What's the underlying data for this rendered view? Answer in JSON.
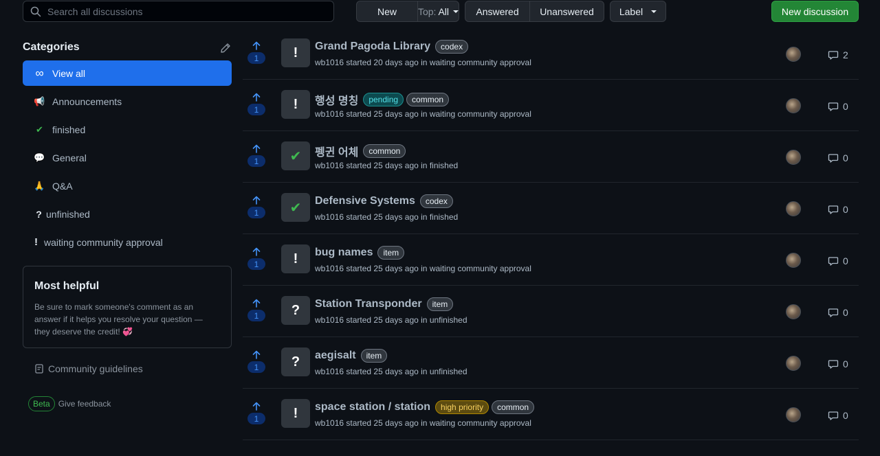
{
  "toolbar": {
    "search_placeholder": "Search all discussions",
    "new_label": "New",
    "top_prefix": "Top:",
    "top_value": "All",
    "answered_label": "Answered",
    "unanswered_label": "Unanswered",
    "label_label": "Label",
    "new_discussion_label": "New discussion"
  },
  "sidebar": {
    "title": "Categories",
    "items": [
      {
        "label": "View all",
        "icon": "infinity-icon",
        "glyph": "∞",
        "active": true
      },
      {
        "label": "Announcements",
        "icon": "megaphone-icon",
        "glyph": "📢"
      },
      {
        "label": "finished",
        "icon": "check-icon",
        "glyph": "✔"
      },
      {
        "label": "General",
        "icon": "speech-bubble-icon",
        "glyph": "💬"
      },
      {
        "label": "Q&A",
        "icon": "pray-icon",
        "glyph": "🙏"
      },
      {
        "label": "unfinished",
        "icon": "question-icon",
        "glyph": "?"
      },
      {
        "label": "waiting community approval",
        "icon": "exclamation-icon",
        "glyph": "!"
      }
    ],
    "helpful": {
      "title": "Most helpful",
      "text": "Be sure to mark someone's comment as an answer if it helps you resolve your question — they deserve the credit!",
      "emoji": "💞"
    },
    "guidelines_label": "Community guidelines",
    "beta_label": "Beta",
    "feedback_label": "Give feedback"
  },
  "discussions": [
    {
      "title": "Grand Pagoda Library",
      "labels": [
        {
          "text": "codex",
          "kind": "default"
        }
      ],
      "author": "wb1016",
      "when": "started 20 days ago in",
      "category": "waiting community approval",
      "category_glyph": "!",
      "votes": "1",
      "comments": "2"
    },
    {
      "title": "행성 명칭",
      "labels": [
        {
          "text": "pending",
          "kind": "pending"
        },
        {
          "text": "common",
          "kind": "default"
        }
      ],
      "author": "wb1016",
      "when": "started 25 days ago in",
      "category": "waiting community approval",
      "category_glyph": "!",
      "votes": "1",
      "comments": "0"
    },
    {
      "title": "펭귄 어체",
      "labels": [
        {
          "text": "common",
          "kind": "default"
        }
      ],
      "author": "wb1016",
      "when": "started 25 days ago in",
      "category": "finished",
      "category_glyph": "✔",
      "votes": "1",
      "comments": "0"
    },
    {
      "title": "Defensive Systems",
      "labels": [
        {
          "text": "codex",
          "kind": "default"
        }
      ],
      "author": "wb1016",
      "when": "started 25 days ago in",
      "category": "finished",
      "category_glyph": "✔",
      "votes": "1",
      "comments": "0"
    },
    {
      "title": "bug names",
      "labels": [
        {
          "text": "item",
          "kind": "default"
        }
      ],
      "author": "wb1016",
      "when": "started 25 days ago in",
      "category": "waiting community approval",
      "category_glyph": "!",
      "votes": "1",
      "comments": "0"
    },
    {
      "title": "Station Transponder",
      "labels": [
        {
          "text": "item",
          "kind": "default"
        }
      ],
      "author": "wb1016",
      "when": "started 25 days ago in",
      "category": "unfinished",
      "category_glyph": "?",
      "votes": "1",
      "comments": "0"
    },
    {
      "title": "aegisalt",
      "labels": [
        {
          "text": "item",
          "kind": "default"
        }
      ],
      "author": "wb1016",
      "when": "started 25 days ago in",
      "category": "unfinished",
      "category_glyph": "?",
      "votes": "1",
      "comments": "0"
    },
    {
      "title": "space station / station",
      "labels": [
        {
          "text": "high priority",
          "kind": "high"
        },
        {
          "text": "common",
          "kind": "default"
        }
      ],
      "author": "wb1016",
      "when": "started 25 days ago in",
      "category": "waiting community approval",
      "category_glyph": "!",
      "votes": "1",
      "comments": "0"
    }
  ],
  "colors": {
    "accent": "#1f6feb",
    "primary": "#238636",
    "check": "#3fb950",
    "upvote": "#4493f8"
  }
}
